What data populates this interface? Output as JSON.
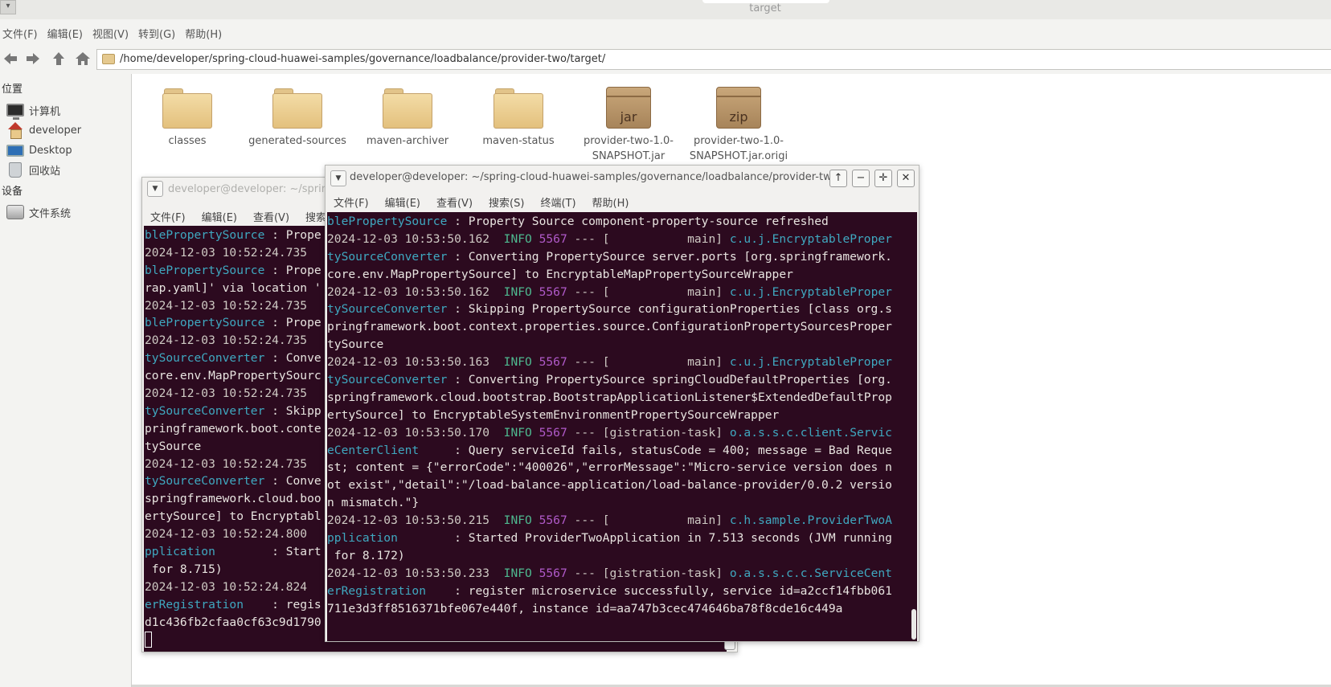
{
  "window": {
    "title": "target",
    "corner_glyph": "▾"
  },
  "file_manager": {
    "menu": [
      "文件(F)",
      "编辑(E)",
      "视图(V)",
      "转到(G)",
      "帮助(H)"
    ],
    "toolbar": {
      "back_icon": "arrow-left-icon",
      "forward_icon": "arrow-right-icon",
      "up_icon": "arrow-up-icon",
      "home_icon": "home-icon"
    },
    "path": "/home/developer/spring-cloud-huawei-samples/governance/loadbalance/provider-two/target/",
    "sidebar": {
      "places_heading": "位置",
      "places": [
        {
          "label": "计算机",
          "icon": "computer-icon"
        },
        {
          "label": "developer",
          "icon": "home-folder-icon"
        },
        {
          "label": "Desktop",
          "icon": "desktop-icon"
        },
        {
          "label": "回收站",
          "icon": "trash-icon"
        }
      ],
      "devices_heading": "设备",
      "devices": [
        {
          "label": "文件系统",
          "icon": "disk-icon"
        }
      ]
    },
    "files": [
      {
        "name": "classes",
        "type": "folder"
      },
      {
        "name": "generated-sources",
        "type": "folder"
      },
      {
        "name": "maven-archiver",
        "type": "folder"
      },
      {
        "name": "maven-status",
        "type": "folder"
      },
      {
        "name_line1": "provider-two-1.0-",
        "name_line2": "SNAPSHOT.jar",
        "type": "jar",
        "badge": "jar"
      },
      {
        "name_line1": "provider-two-1.0-",
        "name_line2": "SNAPSHOT.jar.origi",
        "type": "zip",
        "badge": "zip"
      }
    ]
  },
  "terminal_back": {
    "title": "developer@developer: ~/spring",
    "menu": [
      "文件(F)",
      "编辑(E)",
      "查看(V)",
      "搜索("
    ],
    "lines": [
      "blePropertySource : Prope",
      "2024-12-03 10:52:24.735",
      "blePropertySource : Prope",
      "rap.yaml]' via location '",
      "2024-12-03 10:52:24.735",
      "blePropertySource : Prope",
      "2024-12-03 10:52:24.735",
      "tySourceConverter : Conve",
      "core.env.MapPropertySourc",
      "2024-12-03 10:52:24.735",
      "tySourceConverter : Skipp",
      "pringframework.boot.conte",
      "tySource",
      "2024-12-03 10:52:24.735",
      "tySourceConverter : Conve",
      "springframework.cloud.boo",
      "ertySource] to Encryptabl",
      "2024-12-03 10:52:24.800",
      "pplication        : Start",
      " for 8.715)",
      "2024-12-03 10:52:24.824",
      "erRegistration    : regis",
      "d1c436fb2cfaa0cf63c9d1790"
    ]
  },
  "terminal_front": {
    "title": "developer@developer: ~/spring-cloud-huawei-samples/governance/loadbalance/provider-two/targ",
    "window_buttons": {
      "up": "↑",
      "minimize": "−",
      "maximize": "✛",
      "close": "✕"
    },
    "menu": [
      "文件(F)",
      "编辑(E)",
      "查看(V)",
      "搜索(S)",
      "终端(T)",
      "帮助(H)"
    ],
    "log": [
      {
        "kind": "cont",
        "cls": "blePropertySource",
        "text": " : Property Source component-property-source refreshed"
      },
      {
        "kind": "entry",
        "ts": "2024-12-03 10:53:50.162",
        "level": "INFO",
        "pid": "5567",
        "mid": " --- [           main] ",
        "logger": "c.u.j.EncryptableProper"
      },
      {
        "kind": "cont",
        "cls": "tySourceConverter",
        "text": " : Converting PropertySource server.ports [org.springframework."
      },
      {
        "kind": "plain",
        "text": "core.env.MapPropertySource] to EncryptableMapPropertySourceWrapper"
      },
      {
        "kind": "entry",
        "ts": "2024-12-03 10:53:50.162",
        "level": "INFO",
        "pid": "5567",
        "mid": " --- [           main] ",
        "logger": "c.u.j.EncryptableProper"
      },
      {
        "kind": "cont",
        "cls": "tySourceConverter",
        "text": " : Skipping PropertySource configurationProperties [class org.s"
      },
      {
        "kind": "plain",
        "text": "pringframework.boot.context.properties.source.ConfigurationPropertySourcesProper"
      },
      {
        "kind": "plain",
        "text": "tySource"
      },
      {
        "kind": "entry",
        "ts": "2024-12-03 10:53:50.163",
        "level": "INFO",
        "pid": "5567",
        "mid": " --- [           main] ",
        "logger": "c.u.j.EncryptableProper"
      },
      {
        "kind": "cont",
        "cls": "tySourceConverter",
        "text": " : Converting PropertySource springCloudDefaultProperties [org."
      },
      {
        "kind": "plain",
        "text": "springframework.cloud.bootstrap.BootstrapApplicationListener$ExtendedDefaultProp"
      },
      {
        "kind": "plain",
        "text": "ertySource] to EncryptableSystemEnvironmentPropertySourceWrapper"
      },
      {
        "kind": "entry",
        "ts": "2024-12-03 10:53:50.170",
        "level": "INFO",
        "pid": "5567",
        "mid": " --- [gistration-task] ",
        "logger": "o.a.s.s.c.client.Servic"
      },
      {
        "kind": "cont",
        "cls": "eCenterClient    ",
        "text": " : Query serviceId fails, statusCode = 400; message = Bad Reque"
      },
      {
        "kind": "plain",
        "text": "st; content = {\"errorCode\":\"400026\",\"errorMessage\":\"Micro-service version does n"
      },
      {
        "kind": "plain",
        "text": "ot exist\",\"detail\":\"/load-balance-application/load-balance-provider/0.0.2 versio"
      },
      {
        "kind": "plain",
        "text": "n mismatch.\"}"
      },
      {
        "kind": "entry",
        "ts": "2024-12-03 10:53:50.215",
        "level": "INFO",
        "pid": "5567",
        "mid": " --- [           main] ",
        "logger": "c.h.sample.ProviderTwoA"
      },
      {
        "kind": "cont",
        "cls": "pplication       ",
        "text": " : Started ProviderTwoApplication in 7.513 seconds (JVM running"
      },
      {
        "kind": "plain",
        "text": " for 8.172)"
      },
      {
        "kind": "entry",
        "ts": "2024-12-03 10:53:50.233",
        "level": "INFO",
        "pid": "5567",
        "mid": " --- [gistration-task] ",
        "logger": "o.a.s.s.c.c.ServiceCent"
      },
      {
        "kind": "cont",
        "cls": "erRegistration   ",
        "text": " : register microservice successfully, service id=a2ccf14fbb061"
      },
      {
        "kind": "plain",
        "text": "711e3d3ff8516371bfe067e440f, instance id=aa747b3cec474646ba78f8cde16c449a"
      }
    ]
  },
  "colors": {
    "terminal_bg": "#2c0a1f",
    "info": "#4eb88f",
    "pid": "#b05ac9",
    "class": "#3fa8c0"
  }
}
